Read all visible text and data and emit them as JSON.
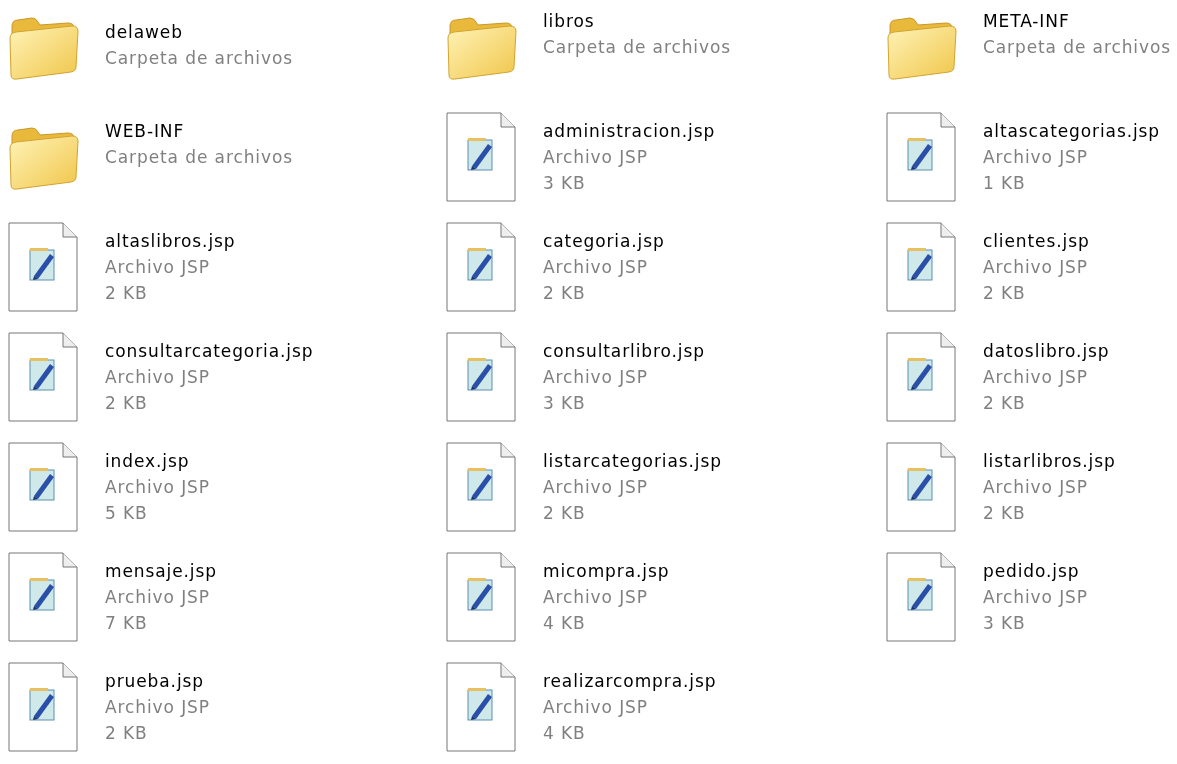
{
  "items": [
    {
      "kind": "folder",
      "name": "delaweb",
      "type": "Carpeta de archivos"
    },
    {
      "kind": "folder",
      "name": "libros",
      "type": "Carpeta de archivos"
    },
    {
      "kind": "folder",
      "name": "META-INF",
      "type": "Carpeta de archivos"
    },
    {
      "kind": "folder",
      "name": "WEB-INF",
      "type": "Carpeta de archivos"
    },
    {
      "kind": "file",
      "name": "administracion.jsp",
      "type": "Archivo JSP",
      "size": "3 KB"
    },
    {
      "kind": "file",
      "name": "altascategorias.jsp",
      "type": "Archivo JSP",
      "size": "1 KB"
    },
    {
      "kind": "file",
      "name": "altaslibros.jsp",
      "type": "Archivo JSP",
      "size": "2 KB"
    },
    {
      "kind": "file",
      "name": "categoria.jsp",
      "type": "Archivo JSP",
      "size": "2 KB"
    },
    {
      "kind": "file",
      "name": "clientes.jsp",
      "type": "Archivo JSP",
      "size": "2 KB"
    },
    {
      "kind": "file",
      "name": "consultarcategoria.jsp",
      "type": "Archivo JSP",
      "size": "2 KB"
    },
    {
      "kind": "file",
      "name": "consultarlibro.jsp",
      "type": "Archivo JSP",
      "size": "3 KB"
    },
    {
      "kind": "file",
      "name": "datoslibro.jsp",
      "type": "Archivo JSP",
      "size": "2 KB"
    },
    {
      "kind": "file",
      "name": "index.jsp",
      "type": "Archivo JSP",
      "size": "5 KB"
    },
    {
      "kind": "file",
      "name": "listarcategorias.jsp",
      "type": "Archivo JSP",
      "size": "2 KB"
    },
    {
      "kind": "file",
      "name": "listarlibros.jsp",
      "type": "Archivo JSP",
      "size": "2 KB"
    },
    {
      "kind": "file",
      "name": "mensaje.jsp",
      "type": "Archivo JSP",
      "size": "7 KB"
    },
    {
      "kind": "file",
      "name": "micompra.jsp",
      "type": "Archivo JSP",
      "size": "4 KB"
    },
    {
      "kind": "file",
      "name": "pedido.jsp",
      "type": "Archivo JSP",
      "size": "3 KB"
    },
    {
      "kind": "file",
      "name": "prueba.jsp",
      "type": "Archivo JSP",
      "size": "2 KB"
    },
    {
      "kind": "file",
      "name": "realizarcompra.jsp",
      "type": "Archivo JSP",
      "size": "4 KB"
    }
  ]
}
